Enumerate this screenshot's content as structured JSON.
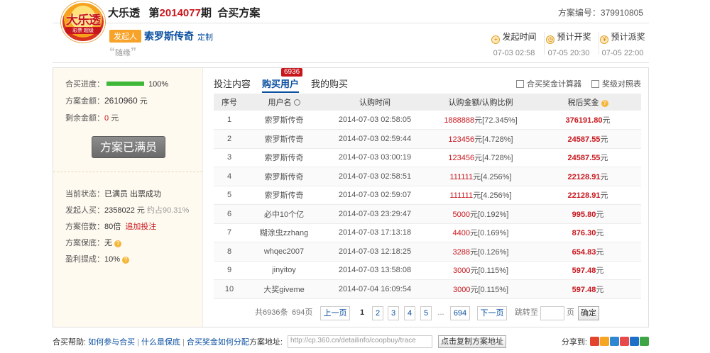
{
  "header": {
    "logo_text": "大乐透",
    "logo_sub": "彩票 超级",
    "game": "大乐透",
    "issue_prefix": "第",
    "issue": "2014077",
    "issue_suffix": "期",
    "type": "合买方案",
    "plan_no": "方案编号：379910805"
  },
  "initiator": {
    "badge": "发起人",
    "name": "索罗斯传奇",
    "custom": "定制",
    "quote": "随缘"
  },
  "timeline": [
    {
      "label": "发起时间",
      "value": "07-03 02:58",
      "icon": "+"
    },
    {
      "label": "预计开奖",
      "value": "07-05 20:30",
      "icon": "◷"
    },
    {
      "label": "预计派奖",
      "value": "07-05 22:00",
      "icon": "¥"
    }
  ],
  "side": {
    "progress_label": "合买进度：",
    "progress_value": "100%",
    "progress_fraction": 1.0,
    "amount_label": "方案金额：",
    "amount_value": "2610960",
    "amount_unit": "元",
    "remain_label": "剩余金额：",
    "remain_value": "0",
    "remain_unit": "元",
    "full_button": "方案已满员",
    "status_label": "当前状态：",
    "status_value": "已满员 出票成功",
    "buy_label": "发起人买：",
    "buy_value": "2358022",
    "buy_unit": "元",
    "buy_pct": "约占90.31%",
    "mult_label": "方案倍数：",
    "mult_value": "80倍",
    "mult_link": "追加投注",
    "guarantee_label": "方案保底：",
    "guarantee_value": "无",
    "commission_label": "盈利提成：",
    "commission_value": "10%"
  },
  "tabs": [
    {
      "label": "投注内容"
    },
    {
      "label": "购买用户",
      "badge": "6936"
    },
    {
      "label": "我的购买"
    }
  ],
  "tools": {
    "calc": "合买奖金计算器",
    "prize": "奖级对照表"
  },
  "table": {
    "headers": [
      "序号",
      "用户名",
      "认购时间",
      "认购金额/认购比例",
      "税后奖金"
    ],
    "rows": [
      {
        "no": "1",
        "user": "索罗斯传奇",
        "time": "2014-07-03 02:58:05",
        "amount": "1888888",
        "ratio": "[72.345%]",
        "bonus": "376191.80"
      },
      {
        "no": "2",
        "user": "索罗斯传奇",
        "time": "2014-07-03 02:59:44",
        "amount": "123456",
        "ratio": "[4.728%]",
        "bonus": "24587.55"
      },
      {
        "no": "3",
        "user": "索罗斯传奇",
        "time": "2014-07-03 03:00:19",
        "amount": "123456",
        "ratio": "[4.728%]",
        "bonus": "24587.55"
      },
      {
        "no": "4",
        "user": "索罗斯传奇",
        "time": "2014-07-03 02:58:51",
        "amount": "111111",
        "ratio": "[4.256%]",
        "bonus": "22128.91"
      },
      {
        "no": "5",
        "user": "索罗斯传奇",
        "time": "2014-07-03 02:59:07",
        "amount": "111111",
        "ratio": "[4.256%]",
        "bonus": "22128.91"
      },
      {
        "no": "6",
        "user": "必中10个亿",
        "time": "2014-07-03 23:29:47",
        "amount": "5000",
        "ratio": "[0.192%]",
        "bonus": "995.80"
      },
      {
        "no": "7",
        "user": "糊涂虫zzhang",
        "time": "2014-07-03 17:13:18",
        "amount": "4400",
        "ratio": "[0.169%]",
        "bonus": "876.30"
      },
      {
        "no": "8",
        "user": "whqec2007",
        "time": "2014-07-03 12:18:25",
        "amount": "3288",
        "ratio": "[0.126%]",
        "bonus": "654.83"
      },
      {
        "no": "9",
        "user": "jinyitoy",
        "time": "2014-07-03 13:58:08",
        "amount": "3000",
        "ratio": "[0.115%]",
        "bonus": "597.48"
      },
      {
        "no": "10",
        "user": "大奖giveme",
        "time": "2014-07-04 16:09:54",
        "amount": "3000",
        "ratio": "[0.115%]",
        "bonus": "597.48"
      }
    ],
    "unit": "元"
  },
  "pager": {
    "total": "共6936条",
    "pages": "694页",
    "prev": "上一页",
    "page_numbers": [
      "1",
      "2",
      "3",
      "4",
      "5"
    ],
    "ellipsis": "...",
    "last": "694",
    "next": "下一页",
    "jump_label": "跳转至",
    "page_unit": "页",
    "ok": "确定"
  },
  "footer": {
    "help_label": "合买帮助:",
    "links": [
      "如何参与合买",
      "什么是保底",
      "合买奖金如何分配"
    ],
    "addr_label": "方案地址:",
    "addr_value": "http://cp.360.cn/detailinfo/coopbuy/trace",
    "copy_button": "点击复制方案地址",
    "share_label": "分享到:"
  },
  "colors": {
    "accent_red": "#c8161d",
    "link_blue": "#0b4fa0",
    "progress_green": "#3fb83a",
    "badge_orange": "#f7a32a"
  }
}
